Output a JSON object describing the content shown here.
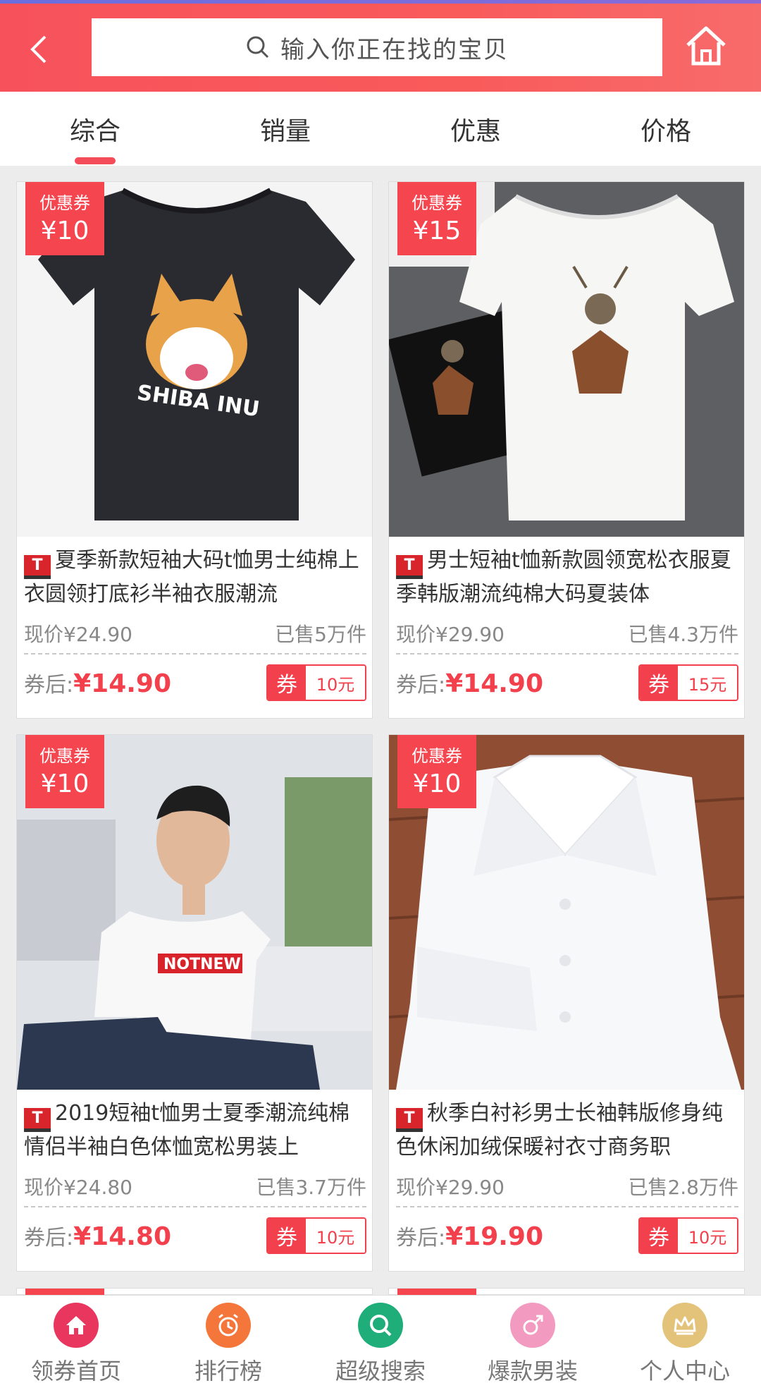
{
  "header": {
    "back_icon": "chevron-left-icon",
    "search_placeholder": "输入你正在找的宝贝",
    "home_icon": "home-icon",
    "colors": {
      "bar": "#f7525c",
      "accent": "#f2404c"
    }
  },
  "sort_tabs": [
    {
      "label": "综合",
      "active": true
    },
    {
      "label": "销量",
      "active": false
    },
    {
      "label": "优惠",
      "active": false
    },
    {
      "label": "价格",
      "active": false
    }
  ],
  "products": [
    {
      "coupon_flag_label": "优惠券",
      "coupon_flag_amount": "¥10",
      "title": "夏季新款短袖大码t恤男士纯棉上衣圆领打底衫半袖衣服潮流",
      "current_price": "现价¥24.90",
      "sold": "已售5万件",
      "after_label": "券后:",
      "after_price": "¥14.90",
      "quan_label": "券",
      "quan_value": "10元",
      "image": "black-tshirt-shiba-inu"
    },
    {
      "coupon_flag_label": "优惠券",
      "coupon_flag_amount": "¥15",
      "title": "男士短袖t恤新款圆领宽松衣服夏季韩版潮流纯棉大码夏装体",
      "current_price": "现价¥29.90",
      "sold": "已售4.3万件",
      "after_label": "券后:",
      "after_price": "¥14.90",
      "quan_label": "券",
      "quan_value": "15元",
      "image": "white-tshirt-deer"
    },
    {
      "coupon_flag_label": "优惠券",
      "coupon_flag_amount": "¥10",
      "title": "2019短袖t恤男士夏季潮流纯棉情侣半袖白色体恤宽松男装上",
      "current_price": "现价¥24.80",
      "sold": "已售3.7万件",
      "after_label": "券后:",
      "after_price": "¥14.80",
      "quan_label": "券",
      "quan_value": "10元",
      "image": "model-white-tshirt"
    },
    {
      "coupon_flag_label": "优惠券",
      "coupon_flag_amount": "¥10",
      "title": "秋季白衬衫男士长袖韩版修身纯色休闲加绒保暖衬衣寸商务职",
      "current_price": "现价¥29.90",
      "sold": "已售2.8万件",
      "after_label": "券后:",
      "after_price": "¥19.90",
      "quan_label": "券",
      "quan_value": "10元",
      "image": "white-dress-shirt"
    }
  ],
  "bottom_nav": [
    {
      "label": "领券首页",
      "icon": "home-icon",
      "color": "#e8365e"
    },
    {
      "label": "排行榜",
      "icon": "alarm-clock-icon",
      "color": "#f4763a"
    },
    {
      "label": "超级搜索",
      "icon": "search-icon",
      "color": "#1fae7a"
    },
    {
      "label": "爆款男装",
      "icon": "male-icon",
      "color": "#f29ac0"
    },
    {
      "label": "个人中心",
      "icon": "crown-icon",
      "color": "#e3c27a"
    }
  ]
}
